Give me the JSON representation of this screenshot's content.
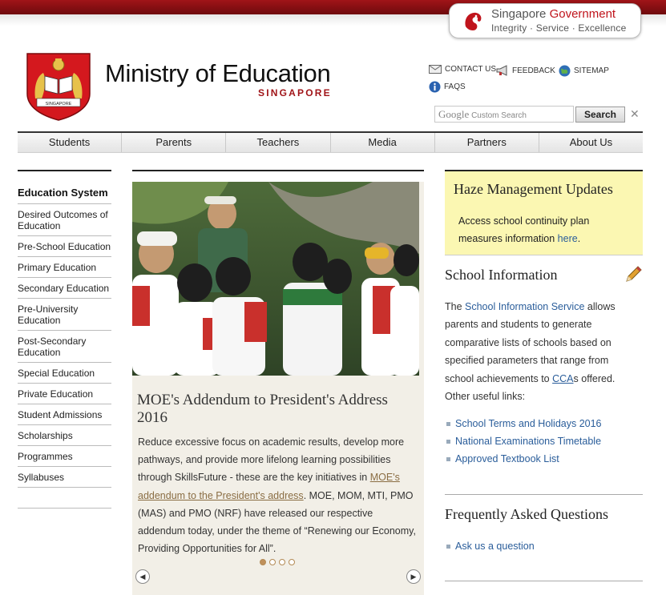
{
  "gov_badge": {
    "line1_a": "Singapore ",
    "line1_b": "Government",
    "line2": "Integrity · Service · Excellence"
  },
  "logo": {
    "ministry": "Ministry of Education",
    "country": "SINGAPORE",
    "crest_text": "SINGAPORE"
  },
  "utility_links": {
    "contact": "CONTACT US",
    "feedback": "FEEDBACK",
    "sitemap": "SITEMAP",
    "faqs": "FAQS"
  },
  "search": {
    "google": "Google",
    "placeholder": "Custom Search",
    "button": "Search",
    "clear": "✕"
  },
  "nav": {
    "tabs": [
      "Students",
      "Parents",
      "Teachers",
      "Media",
      "Partners",
      "About Us"
    ]
  },
  "sidebar": {
    "heading": "Education System",
    "items": [
      "Desired Outcomes of Education",
      "Pre-School Education",
      "Primary Education",
      "Secondary Education",
      "Pre-University Education",
      "Post-Secondary Education",
      "Special Education",
      "Private Education",
      "Student Admissions",
      "Scholarships",
      "Programmes",
      "Syllabuses"
    ]
  },
  "feature": {
    "title": "MOE's Addendum to President's Address 2016",
    "body_a": "Reduce excessive focus on academic results, develop more pathways, and provide more lifelong learning possibilities through SkillsFuture - these are the key initiatives in ",
    "body_link": "MOE's addendum to the President's address",
    "body_b": ". MOE, MOM, MTI, PMO (MAS) and PMO (NRF) have released our respective addendum today, under the theme of “Renewing our Economy, Providing Opportunities for All”.",
    "slides_total": 4,
    "slide_active": 1,
    "prev": "◀",
    "next": "▶"
  },
  "haze": {
    "title": "Haze Management Updates",
    "body_a": "Access school continuity plan measures information ",
    "body_link": "here",
    "body_b": "."
  },
  "school_info": {
    "title": "School Information",
    "body_a": "The ",
    "body_link": "School Information Service",
    "body_b": " allows parents and students to generate comparative lists of schools based on specified parameters that range from school achievements to ",
    "body_link2": "CCA",
    "body_c": "s offered. Other useful links:",
    "links": [
      "School Terms and Holidays 2016",
      "National Examinations Timetable",
      "Approved Textbook List"
    ]
  },
  "faq": {
    "title": "Frequently Asked Questions",
    "links": [
      "Ask us a question"
    ]
  },
  "colors": {
    "brand_red": "#a01418",
    "link_blue": "#2a5d9a",
    "haze_bg": "#fbf7b2",
    "feature_bg": "#f2efe7"
  }
}
